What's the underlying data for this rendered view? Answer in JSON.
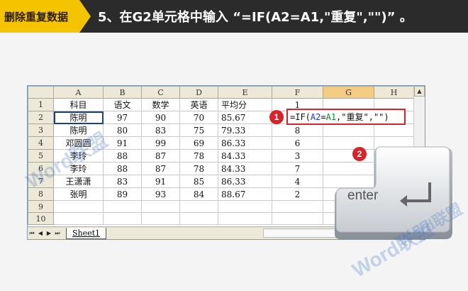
{
  "banner": {
    "tag": "删除重复数据",
    "instruction": "5、在G2单元格中输入 “=IF(A2=A1,\"重复\",\"\")” 。"
  },
  "spreadsheet": {
    "column_headers": [
      "A",
      "B",
      "C",
      "D",
      "E",
      "F",
      "G",
      "H"
    ],
    "selected_column": "G",
    "row_numbers": [
      "1",
      "2",
      "3",
      "4",
      "5",
      "6",
      "7",
      "8",
      "9",
      "10"
    ],
    "rows": [
      [
        "科目",
        "语文",
        "数学",
        "英语",
        "平均分",
        "1",
        "",
        ""
      ],
      [
        "陈明",
        "97",
        "90",
        "70",
        "85.67",
        "",
        "",
        ""
      ],
      [
        "陈明",
        "80",
        "83",
        "75",
        "79.33",
        "8",
        "",
        ""
      ],
      [
        "邓圆圆",
        "91",
        "99",
        "69",
        "86.33",
        "6",
        "",
        ""
      ],
      [
        "李玲",
        "88",
        "87",
        "78",
        "84.33",
        "3",
        "",
        ""
      ],
      [
        "李玲",
        "88",
        "87",
        "78",
        "84.33",
        "7",
        "",
        ""
      ],
      [
        "王潇潇",
        "83",
        "91",
        "85",
        "86.33",
        "4",
        "",
        ""
      ],
      [
        "张明",
        "89",
        "93",
        "84",
        "88.67",
        "2",
        "",
        ""
      ],
      [
        "",
        "",
        "",
        "",
        "",
        "",
        "",
        ""
      ],
      [
        "",
        "",
        "",
        "",
        "",
        "",
        "",
        ""
      ]
    ],
    "sheet_tab": "Sheet1",
    "nav_buttons": [
      "⏮",
      "◀",
      "▶",
      "⏭"
    ]
  },
  "formula": {
    "parts": [
      "=IF(",
      "A2",
      "=",
      "A1",
      ",\"重复\",\"\")"
    ]
  },
  "badges": {
    "step1": "1",
    "step2": "2"
  },
  "enter_key": {
    "label": "enter"
  },
  "watermarks": [
    "Word联盟",
    "Word联盟",
    "Word联盟"
  ],
  "colors": {
    "banner_bg": "#2b2b2b",
    "tag_bg": "#f5c400",
    "badge": "#d8232a",
    "formula_ref1": "#1a39c7",
    "formula_ref2": "#0a8a2a"
  }
}
